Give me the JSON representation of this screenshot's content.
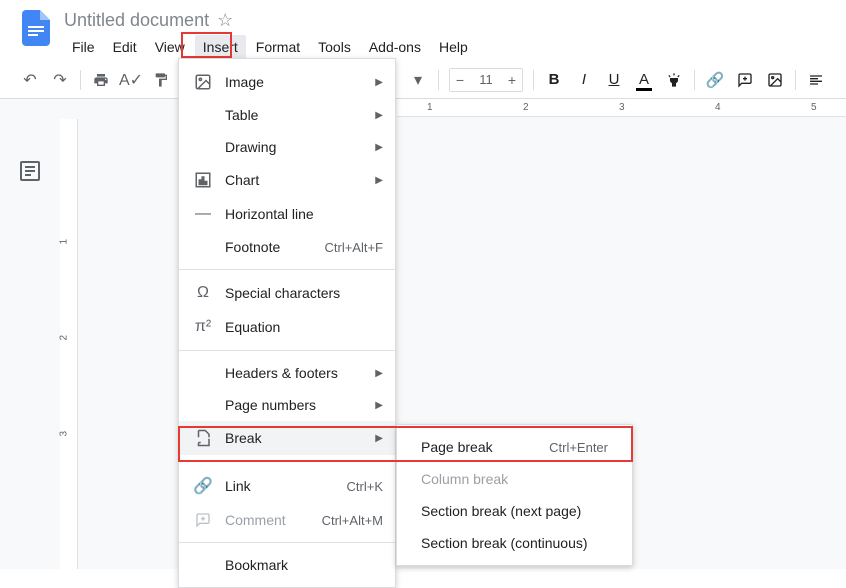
{
  "doc": {
    "title": "Untitled document"
  },
  "menu": {
    "file": "File",
    "edit": "Edit",
    "view": "View",
    "insert": "Insert",
    "format": "Format",
    "tools": "Tools",
    "addons": "Add-ons",
    "help": "Help"
  },
  "toolbar": {
    "fontSize": "11"
  },
  "insertMenu": {
    "image": "Image",
    "table": "Table",
    "drawing": "Drawing",
    "chart": "Chart",
    "hline": "Horizontal line",
    "footnote": "Footnote",
    "footnoteKey": "Ctrl+Alt+F",
    "special": "Special characters",
    "equation": "Equation",
    "headers": "Headers & footers",
    "pagenum": "Page numbers",
    "break": "Break",
    "link": "Link",
    "linkKey": "Ctrl+K",
    "comment": "Comment",
    "commentKey": "Ctrl+Alt+M",
    "bookmark": "Bookmark"
  },
  "breakMenu": {
    "page": "Page break",
    "pageKey": "Ctrl+Enter",
    "column": "Column break",
    "sectionNext": "Section break (next page)",
    "sectionCont": "Section break (continuous)"
  },
  "ruler": {
    "n1": "1",
    "n2": "2",
    "n3": "3",
    "n4": "4",
    "n5": "5"
  },
  "vruler": {
    "n1": "1",
    "n2": "2",
    "n3": "3"
  }
}
